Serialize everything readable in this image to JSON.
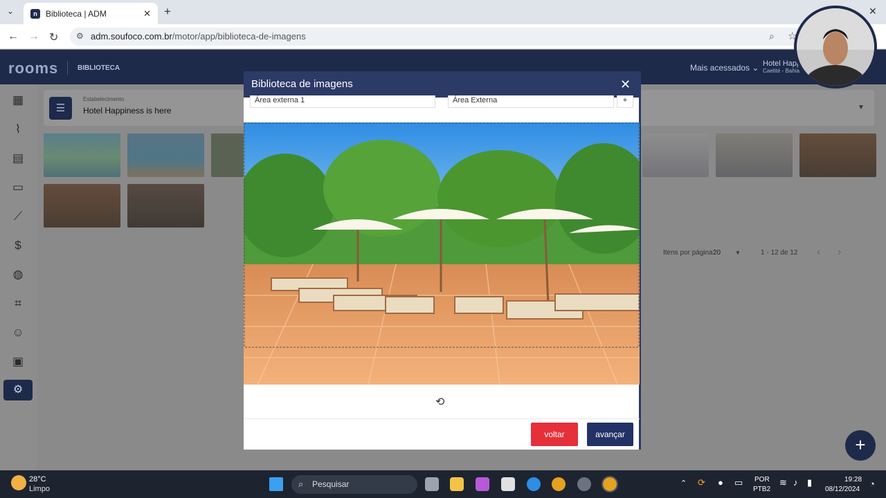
{
  "browser": {
    "tab_title": "Biblioteca | ADM",
    "url_host": "adm.soufoco.com.br",
    "url_path": "/motor/app/biblioteca-de-imagens",
    "favicon_letter": "n"
  },
  "app": {
    "logo": "rooms",
    "section": "BIBLIOTECA",
    "menu_most_accessed": "Mais acessados",
    "hotel_name": "Hotel Happ",
    "hotel_city": "Caetité - Bahia",
    "filter": {
      "label": "Estabelecimento",
      "value": "Hotel Happiness is here"
    },
    "pagination": {
      "items_label": "Itens por página:",
      "items_value": "20",
      "range": "1 - 12 de 12"
    }
  },
  "modal": {
    "title": "Biblioteca de imagens",
    "field_name": "Área externa 1",
    "field_category": "Área Externa",
    "field_add": "+",
    "back_label": "voltar",
    "next_label": "avançar"
  },
  "taskbar": {
    "temperature": "28°C",
    "weather": "Limpo",
    "search_placeholder": "Pesquisar",
    "lang_line1": "POR",
    "lang_line2": "PTB2",
    "time": "19:28",
    "date": "08/12/2024"
  },
  "icons": [
    "calendar-icon",
    "attachment-icon",
    "document-icon",
    "card-icon",
    "chart-icon",
    "money-icon",
    "globe-icon",
    "scan-icon",
    "smile-icon",
    "monitor-icon",
    "user-settings-icon",
    "close-icon",
    "reset-icon",
    "search-icon",
    "plus-icon"
  ],
  "colors": {
    "header_navy": "#1e2a4a",
    "modal_header": "#2c3a66",
    "back_red": "#e5303a",
    "next_navy": "#233266"
  }
}
